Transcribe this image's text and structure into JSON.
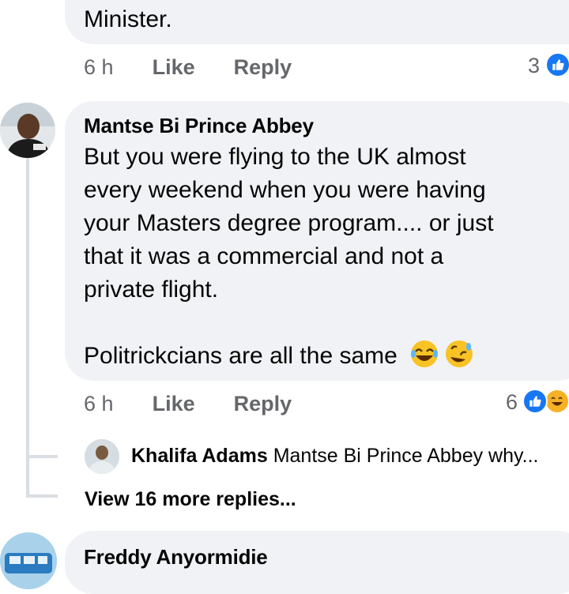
{
  "top_comment": {
    "text_tail": "Minister.",
    "time": "6 h",
    "like_label": "Like",
    "reply_label": "Reply",
    "reaction_count": "3"
  },
  "main_comment": {
    "author": "Mantse Bi Prince Abbey",
    "line1": "But you were flying to the UK almost",
    "line2": "every weekend when you were having",
    "line3": "your Masters degree program.... or just",
    "line4": "that it was a commercial and not a",
    "line5": "private flight.",
    "line6": "Politrickcians are all the same",
    "time": "6 h",
    "like_label": "Like",
    "reply_label": "Reply",
    "reaction_count": "6"
  },
  "reply": {
    "author": "Khalifa Adams",
    "preview": "Mantse Bi Prince Abbey why..."
  },
  "view_more": "View 16 more replies...",
  "last_comment": {
    "author": "Freddy Anyormidie"
  },
  "colors": {
    "bubble": "#f0f2f5",
    "meta": "#65676b",
    "like_blue": "#1877f2",
    "haha_yellow": "#f7b125"
  }
}
